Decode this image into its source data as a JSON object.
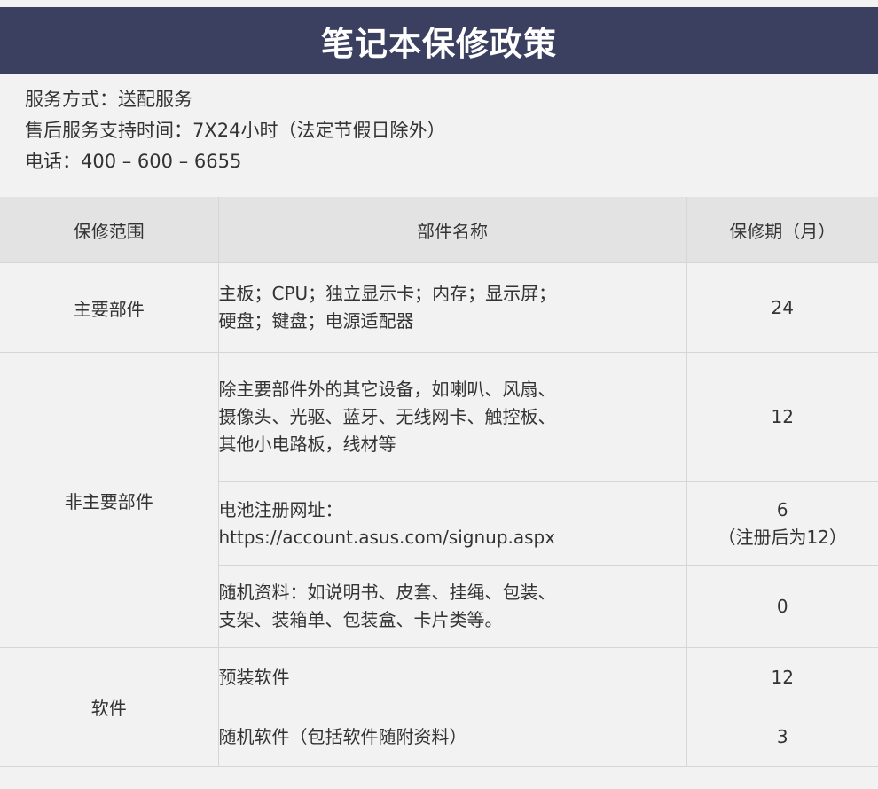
{
  "banner": {
    "title": "笔记本保修政策"
  },
  "info": {
    "service_mode": "服务方式：送配服务",
    "service_hours": "售后服务支持时间：7X24小时（法定节假日除外）",
    "phone": "电话：400 – 600 – 6655"
  },
  "table": {
    "headers": {
      "scope": "保修范围",
      "part_name": "部件名称",
      "period": "保修期（月）"
    },
    "groups": {
      "main": {
        "category": "主要部件",
        "rows": [
          {
            "part_line1": "主板；CPU；独立显示卡；内存；显示屏；",
            "part_line2": "硬盘；键盘；电源适配器",
            "period": "24"
          }
        ]
      },
      "non_main": {
        "category": "非主要部件",
        "rows": [
          {
            "part_line1": "除主要部件外的其它设备，如喇叭、风扇、",
            "part_line2": "摄像头、光驱、蓝牙、无线网卡、触控板、",
            "part_line3": "其他小电路板，线材等",
            "period": "12"
          },
          {
            "part_line1": "电池注册网址：",
            "part_line2": "https://account.asus.com/signup.aspx",
            "period": "6",
            "period_note": "（注册后为12）"
          },
          {
            "part_line1": "随机资料：如说明书、皮套、挂绳、包装、",
            "part_line2": "支架、装箱单、包装盒、卡片类等。",
            "period": "0"
          }
        ]
      },
      "software": {
        "category": "软件",
        "rows": [
          {
            "part_line1": "预装软件",
            "period": "12"
          },
          {
            "part_line1": "随机软件（包括软件随附资料）",
            "period": "3"
          }
        ]
      }
    }
  }
}
